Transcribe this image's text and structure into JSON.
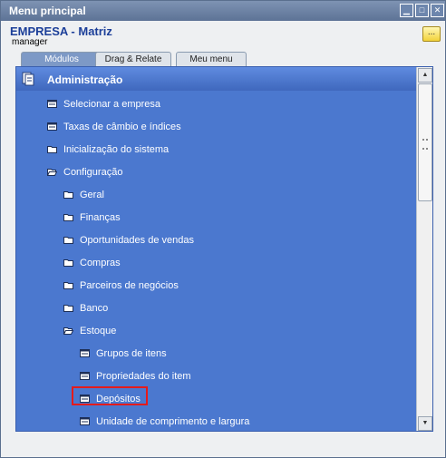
{
  "window": {
    "title": "Menu principal",
    "controls": [
      "minimize-icon",
      "maximize-icon",
      "close-icon"
    ]
  },
  "company": "EMPRESA - Matriz",
  "user": "manager",
  "more_button": "...",
  "tabs": [
    {
      "label": "Módulos",
      "active": true
    },
    {
      "label": "Drag & Relate",
      "active": false
    },
    {
      "label": "Meu menu",
      "active": false
    }
  ],
  "panel": {
    "header": "Administração"
  },
  "menu": [
    {
      "label": "Selecionar a empresa",
      "icon": "doc-icon",
      "level": 0
    },
    {
      "label": "Taxas de câmbio e índices",
      "icon": "doc-icon",
      "level": 0
    },
    {
      "label": "Inicialização do sistema",
      "icon": "folder-icon",
      "level": 0
    },
    {
      "label": "Configuração",
      "icon": "folder-open-icon",
      "level": 0
    },
    {
      "label": "Geral",
      "icon": "folder-icon",
      "level": 1
    },
    {
      "label": "Finanças",
      "icon": "folder-icon",
      "level": 1
    },
    {
      "label": "Oportunidades de vendas",
      "icon": "folder-icon",
      "level": 1
    },
    {
      "label": "Compras",
      "icon": "folder-icon",
      "level": 1
    },
    {
      "label": "Parceiros de negócios",
      "icon": "folder-icon",
      "level": 1
    },
    {
      "label": "Banco",
      "icon": "folder-icon",
      "level": 1
    },
    {
      "label": "Estoque",
      "icon": "folder-open-icon",
      "level": 1
    },
    {
      "label": "Grupos de itens",
      "icon": "doc-icon",
      "level": 2
    },
    {
      "label": "Propriedades do item",
      "icon": "doc-icon",
      "level": 2
    },
    {
      "label": "Depósitos",
      "icon": "doc-icon",
      "level": 2,
      "highlighted": true
    },
    {
      "label": "Unidade de comprimento e largura",
      "icon": "doc-icon",
      "level": 2
    }
  ],
  "colors": {
    "panel": "#4b78cf",
    "highlight": "#e51b1b",
    "title_bar": "#5d7396"
  }
}
